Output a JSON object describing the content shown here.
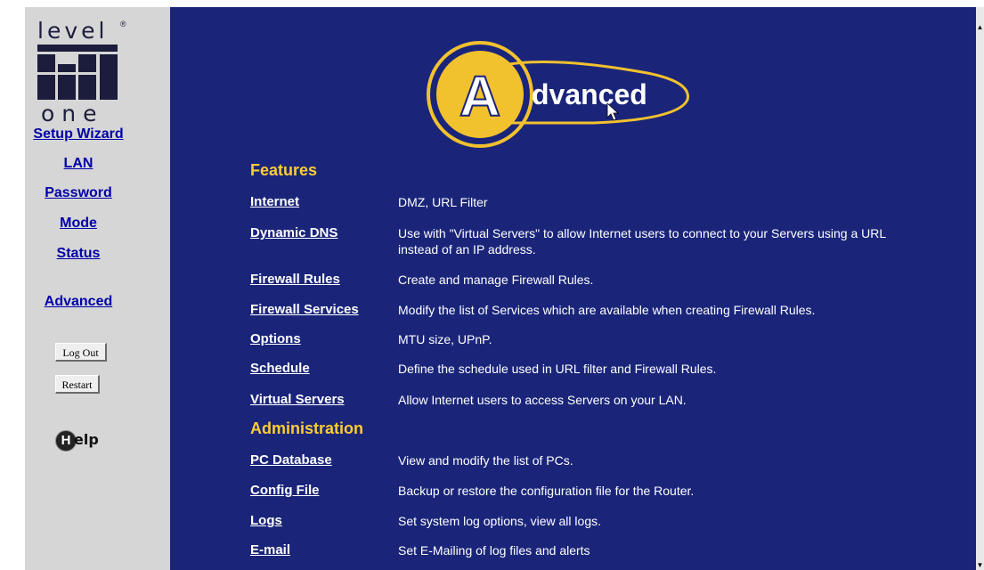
{
  "brand": {
    "line1": "level",
    "line2": "one",
    "reg": "®"
  },
  "nav": {
    "setup_wizard": "Setup Wizard",
    "lan": "LAN",
    "password": "Password",
    "mode": "Mode",
    "status": "Status",
    "advanced": "Advanced"
  },
  "buttons": {
    "logout": "Log Out",
    "restart": "Restart"
  },
  "help": {
    "initial": "H",
    "rest": "elp"
  },
  "banner": {
    "letter": "A",
    "rest": "dvanced"
  },
  "features": {
    "heading": "Features",
    "items": [
      {
        "label": "Internet",
        "desc": "DMZ, URL Filter"
      },
      {
        "label": "Dynamic DNS",
        "desc": "Use with \"Virtual Servers\" to allow Internet users to connect to your Servers using a URL instead of an IP address."
      },
      {
        "label": "Firewall Rules",
        "desc": "Create and manage Firewall Rules."
      },
      {
        "label": "Firewall Services",
        "desc": "Modify the list of Services which are available when creating Firewall Rules."
      },
      {
        "label": "Options",
        "desc": "MTU size, UPnP."
      },
      {
        "label": "Schedule",
        "desc": "Define the schedule used in URL filter and Firewall Rules."
      },
      {
        "label": "Virtual Servers",
        "desc": "Allow Internet users to access Servers on your LAN."
      }
    ]
  },
  "administration": {
    "heading": "Administration",
    "items": [
      {
        "label": "PC Database",
        "desc": "View and modify the list of PCs."
      },
      {
        "label": "Config File",
        "desc": "Backup or restore the configuration file for the Router."
      },
      {
        "label": "Logs",
        "desc": "Set system log options, view all logs."
      },
      {
        "label": "E-mail",
        "desc": "Set E-Mailing of log files and alerts"
      }
    ]
  },
  "colors": {
    "main_bg": "#1a257a",
    "sidebar_bg": "#d6d6d6",
    "heading": "#ffcc33",
    "link": "#0000a8",
    "banner_gold": "#f2c12e"
  }
}
